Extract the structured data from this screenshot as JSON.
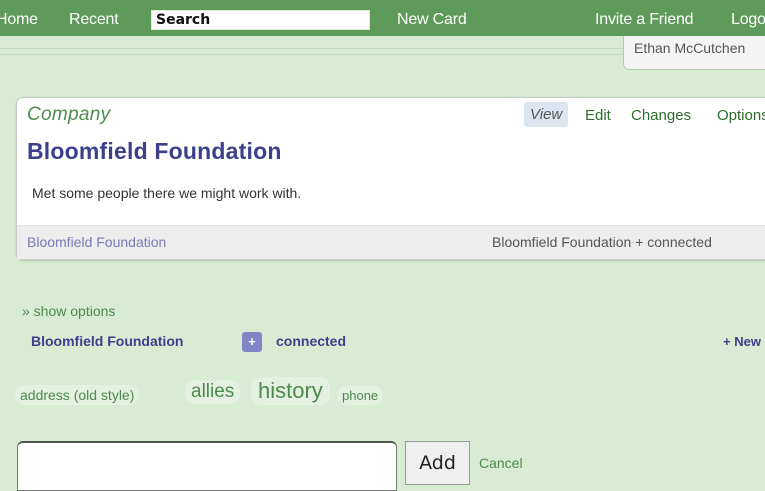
{
  "topbar": {
    "home": "Home",
    "recent": "Recent",
    "search_placeholder": "Search",
    "new_card": "New Card",
    "invite": "Invite a Friend",
    "logout": "Logout",
    "user_name": "Ethan McCutchen"
  },
  "card": {
    "type": "Company",
    "tabs": {
      "view": "View",
      "edit": "Edit",
      "changes": "Changes",
      "options": "Options"
    },
    "title": "Bloomfield Foundation",
    "body": "Met some people there we might work with.",
    "footer_link": "Bloomfield Foundation",
    "footer_right": "Bloomfield Foundation + connected"
  },
  "options": {
    "show_options": "» show options",
    "rel_left": "Bloomfield Foundation",
    "plus": "+",
    "rel_right": "connected",
    "new_link": "+ New"
  },
  "tags": [
    "address (old style)",
    "allies",
    "history",
    "phone"
  ],
  "add_form": {
    "add_label": "Add",
    "cancel_label": "Cancel"
  }
}
